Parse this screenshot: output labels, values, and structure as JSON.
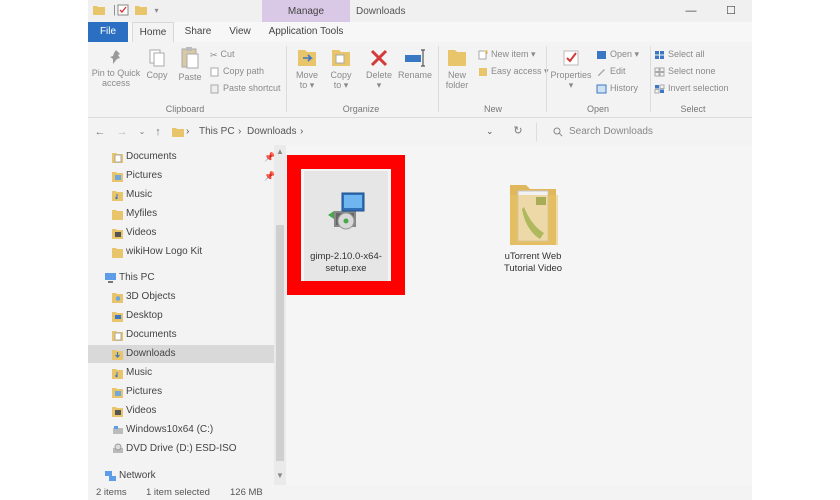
{
  "window": {
    "title": "Downloads",
    "contextual_tab": "Manage"
  },
  "tabs": [
    {
      "label": "File"
    },
    {
      "label": "Home"
    },
    {
      "label": "Share"
    },
    {
      "label": "View"
    },
    {
      "label": "Application Tools"
    }
  ],
  "ribbon": {
    "clipboard": {
      "label": "Clipboard",
      "pin_line1": "Pin to Quick",
      "pin_line2": "access",
      "copy": "Copy",
      "paste": "Paste",
      "cut": "Cut",
      "copy_path": "Copy path",
      "paste_shortcut": "Paste shortcut"
    },
    "organize": {
      "label": "Organize",
      "move_line1": "Move",
      "move_line2": "to",
      "copy_line1": "Copy",
      "copy_line2": "to",
      "delete": "Delete",
      "rename": "Rename"
    },
    "new": {
      "label": "New",
      "folder_line1": "New",
      "folder_line2": "folder",
      "new_item": "New item",
      "easy_access": "Easy access"
    },
    "open": {
      "label": "Open",
      "properties": "Properties",
      "open": "Open",
      "edit": "Edit",
      "history": "History"
    },
    "select": {
      "label": "Select",
      "select_all": "Select all",
      "select_none": "Select none",
      "invert": "Invert selection"
    }
  },
  "address": {
    "segments": [
      "This PC",
      "Downloads"
    ],
    "search_placeholder": "Search Downloads"
  },
  "sidebar": {
    "quick": [
      {
        "label": "Documents",
        "pinned": true
      },
      {
        "label": "Pictures",
        "pinned": true
      },
      {
        "label": "Music"
      },
      {
        "label": "Myfiles"
      },
      {
        "label": "Videos"
      },
      {
        "label": "wikiHow Logo Kit"
      }
    ],
    "this_pc": "This PC",
    "pc_items": [
      {
        "label": "3D Objects"
      },
      {
        "label": "Desktop"
      },
      {
        "label": "Documents"
      },
      {
        "label": "Downloads",
        "selected": true
      },
      {
        "label": "Music"
      },
      {
        "label": "Pictures"
      },
      {
        "label": "Videos"
      },
      {
        "label": "Windows10x64 (C:)"
      },
      {
        "label": "DVD Drive (D:) ESD-ISO"
      }
    ],
    "network": "Network"
  },
  "files": [
    {
      "line1": "gimp-2.10.0-x64-",
      "line2": "setup.exe",
      "selected": true
    },
    {
      "line1": "uTorrent Web",
      "line2": "Tutorial Video"
    }
  ],
  "status": {
    "count": "2 items",
    "selection": "1 item selected",
    "size": "126 MB"
  },
  "colors": {
    "highlight": "#ff0000",
    "file_tab": "#2b6fc2",
    "manage_tab": "#d9c8e6"
  }
}
